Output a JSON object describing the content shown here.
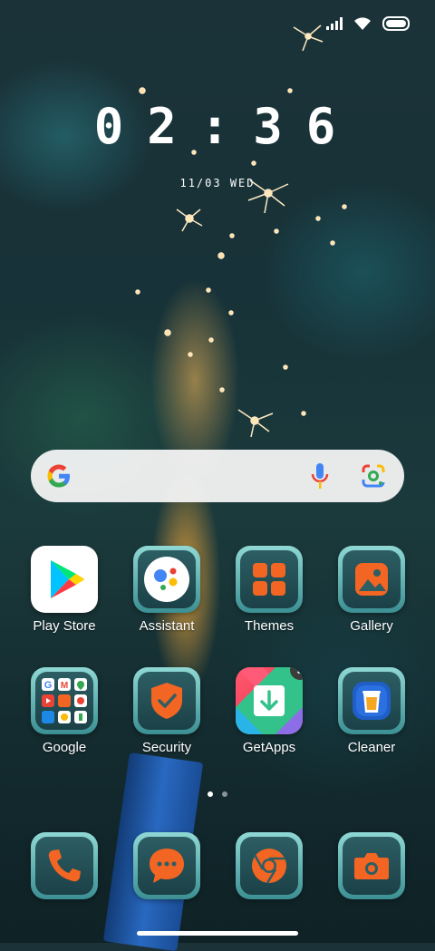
{
  "status_bar": {
    "signal_icon": "cellular-signal-icon",
    "wifi_icon": "wifi-icon",
    "battery_icon": "battery-icon"
  },
  "clock": {
    "time": "02:36",
    "date": "11/03 WED"
  },
  "search": {
    "google_icon": "google-g-icon",
    "mic_icon": "microphone-icon",
    "lens_icon": "google-lens-icon"
  },
  "apps_row1": [
    {
      "label": "Play Store",
      "icon": "play-store-icon"
    },
    {
      "label": "Assistant",
      "icon": "google-assistant-icon"
    },
    {
      "label": "Themes",
      "icon": "themes-icon"
    },
    {
      "label": "Gallery",
      "icon": "gallery-icon"
    }
  ],
  "apps_row2": [
    {
      "label": "Google",
      "icon": "google-folder-icon"
    },
    {
      "label": "Security",
      "icon": "security-shield-icon"
    },
    {
      "label": "GetApps",
      "icon": "getapps-icon",
      "badge": "9"
    },
    {
      "label": "Cleaner",
      "icon": "cleaner-trash-icon"
    }
  ],
  "page_indicator": {
    "pages": 2,
    "current": 1
  },
  "dock": [
    {
      "icon": "phone-icon"
    },
    {
      "icon": "messages-icon"
    },
    {
      "icon": "chrome-icon"
    },
    {
      "icon": "camera-icon"
    }
  ],
  "colors": {
    "accent": "#f26522",
    "tile_teal": "#3b8f92"
  }
}
